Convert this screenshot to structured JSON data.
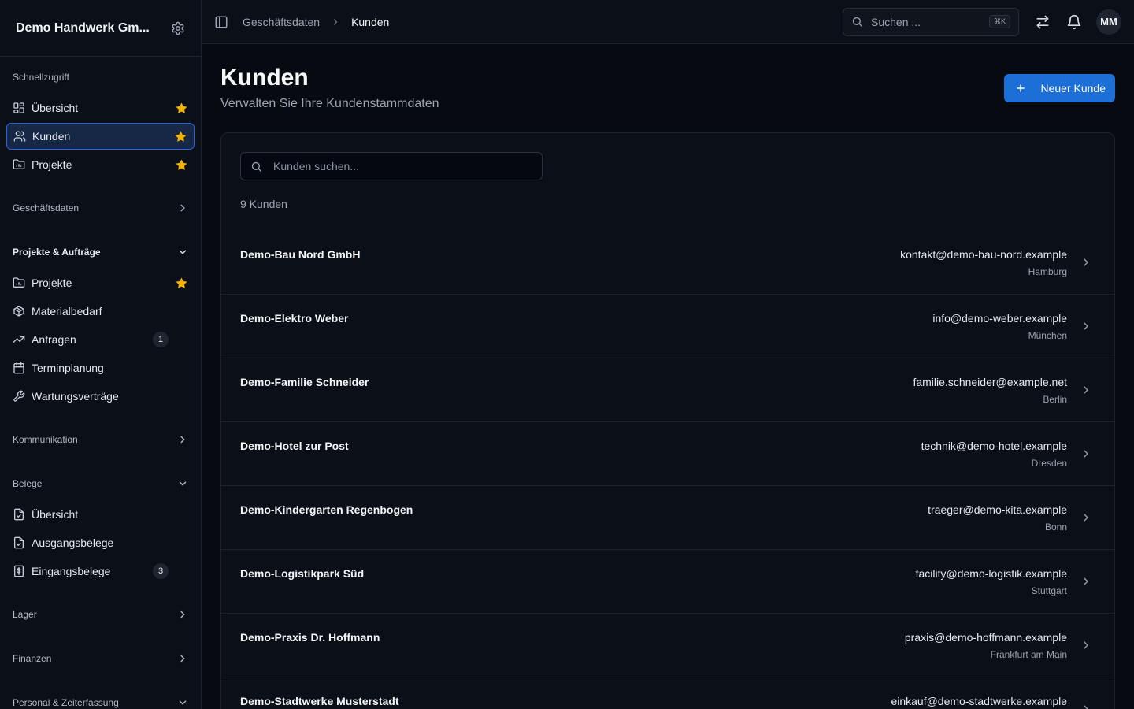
{
  "sidebar": {
    "org_name": "Demo Handwerk Gm...",
    "sections": [
      {
        "title": "Schnellzugriff",
        "items": [
          {
            "label": "Übersicht",
            "icon": "dashboard-icon",
            "star": true
          },
          {
            "label": "Kunden",
            "icon": "users-icon",
            "star": true,
            "active": true
          },
          {
            "label": "Projekte",
            "icon": "folder-chart-icon",
            "star": true
          }
        ]
      },
      {
        "title": "Geschäftsdaten",
        "collapsed": true
      },
      {
        "title": "Projekte & Aufträge",
        "items": [
          {
            "label": "Projekte",
            "icon": "folder-chart-icon",
            "star": true
          },
          {
            "label": "Materialbedarf",
            "icon": "package-icon"
          },
          {
            "label": "Anfragen",
            "icon": "trend-icon",
            "badge": "1"
          },
          {
            "label": "Terminplanung",
            "icon": "calendar-icon"
          },
          {
            "label": "Wartungsverträge",
            "icon": "wrench-icon"
          }
        ]
      },
      {
        "title": "Kommunikation",
        "collapsed": true
      },
      {
        "title": "Belege",
        "items": [
          {
            "label": "Übersicht",
            "icon": "file-check-icon"
          },
          {
            "label": "Ausgangsbelege",
            "icon": "file-check-icon"
          },
          {
            "label": "Eingangsbelege",
            "icon": "receipt-icon",
            "badge": "3"
          }
        ]
      },
      {
        "title": "Lager",
        "collapsed": true
      },
      {
        "title": "Finanzen",
        "collapsed": true
      },
      {
        "title": "Personal & Zeiterfassung"
      }
    ]
  },
  "topbar": {
    "breadcrumb": [
      "Geschäftsdaten",
      "Kunden"
    ],
    "search_placeholder": "Suchen ...",
    "shortcut": "⌘K",
    "avatar": "MM"
  },
  "page": {
    "title": "Kunden",
    "subtitle": "Verwalten Sie Ihre Kundenstammdaten",
    "new_button": "Neuer Kunde",
    "search_placeholder": "Kunden suchen...",
    "count_label": "9 Kunden"
  },
  "customers": [
    {
      "name": "Demo-Bau Nord GmbH",
      "email": "kontakt@demo-bau-nord.example",
      "city": "Hamburg"
    },
    {
      "name": "Demo-Elektro Weber",
      "email": "info@demo-weber.example",
      "city": "München"
    },
    {
      "name": "Demo-Familie Schneider",
      "email": "familie.schneider@example.net",
      "city": "Berlin"
    },
    {
      "name": "Demo-Hotel zur Post",
      "email": "technik@demo-hotel.example",
      "city": "Dresden"
    },
    {
      "name": "Demo-Kindergarten Regenbogen",
      "email": "traeger@demo-kita.example",
      "city": "Bonn"
    },
    {
      "name": "Demo-Logistikpark Süd",
      "email": "facility@demo-logistik.example",
      "city": "Stuttgart"
    },
    {
      "name": "Demo-Praxis Dr. Hoffmann",
      "email": "praxis@demo-hoffmann.example",
      "city": "Frankfurt am Main"
    },
    {
      "name": "Demo-Stadtwerke Musterstadt",
      "email": "einkauf@demo-stadtwerke.example",
      "city": ""
    }
  ],
  "colors": {
    "accent": "#1d6fd8",
    "star": "#f5b301",
    "background": "#070a10"
  }
}
